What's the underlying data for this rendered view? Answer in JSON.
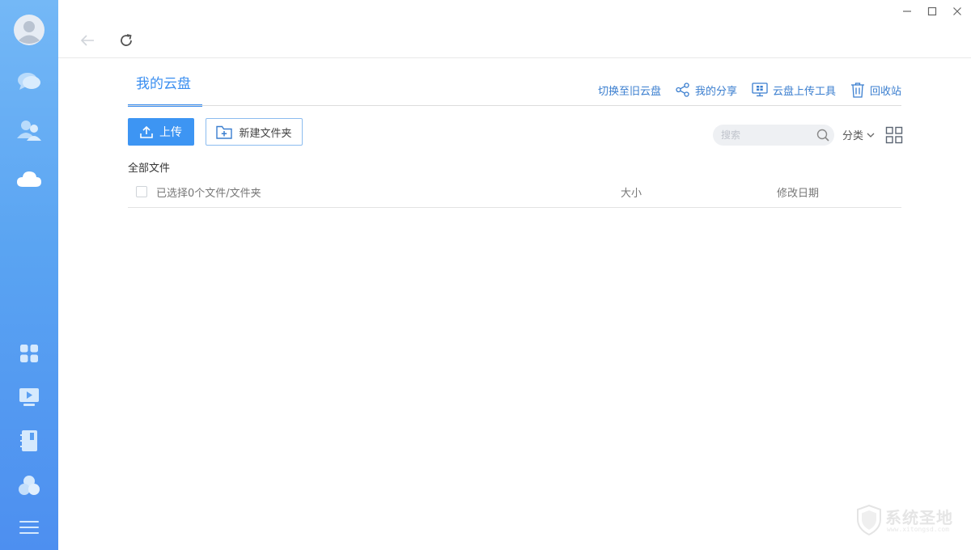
{
  "window": {
    "minimize_icon": "minimize-icon",
    "maximize_icon": "maximize-icon",
    "close_icon": "close-icon"
  },
  "sidebar": {
    "items": [
      {
        "icon": "avatar"
      },
      {
        "icon": "chat-icon"
      },
      {
        "icon": "contacts-icon"
      },
      {
        "icon": "cloud-icon",
        "active": true
      },
      {
        "icon": "apps-icon"
      },
      {
        "icon": "video-icon"
      },
      {
        "icon": "notebook-icon"
      },
      {
        "icon": "circles-icon"
      },
      {
        "icon": "menu-icon"
      }
    ],
    "colors": {
      "top": "#74b8f6",
      "bottom": "#4d8ff0"
    }
  },
  "nav": {
    "back_icon": "back-arrow-icon",
    "refresh_icon": "refresh-icon"
  },
  "header": {
    "title": "我的云盘",
    "links": [
      {
        "label": "切换至旧云盘",
        "icon": ""
      },
      {
        "label": "我的分享",
        "icon": "share-icon"
      },
      {
        "label": "云盘上传工具",
        "icon": "upload-tool-icon"
      },
      {
        "label": "回收站",
        "icon": "trash-icon"
      }
    ]
  },
  "toolbar": {
    "upload_label": "上传",
    "new_folder_label": "新建文件夹",
    "search_placeholder": "搜索",
    "category_label": "分类"
  },
  "file_list": {
    "breadcrumb": "全部文件",
    "selection_text": "已选择0个文件/文件夹",
    "columns": {
      "size": "大小",
      "modified": "修改日期"
    },
    "rows": []
  },
  "watermark": {
    "text": "系统圣地",
    "sub": "www.xitongsd.com"
  },
  "colors": {
    "accent": "#3a8ef0",
    "upload_button": "#3d95f3",
    "link": "#3a7ecf"
  }
}
